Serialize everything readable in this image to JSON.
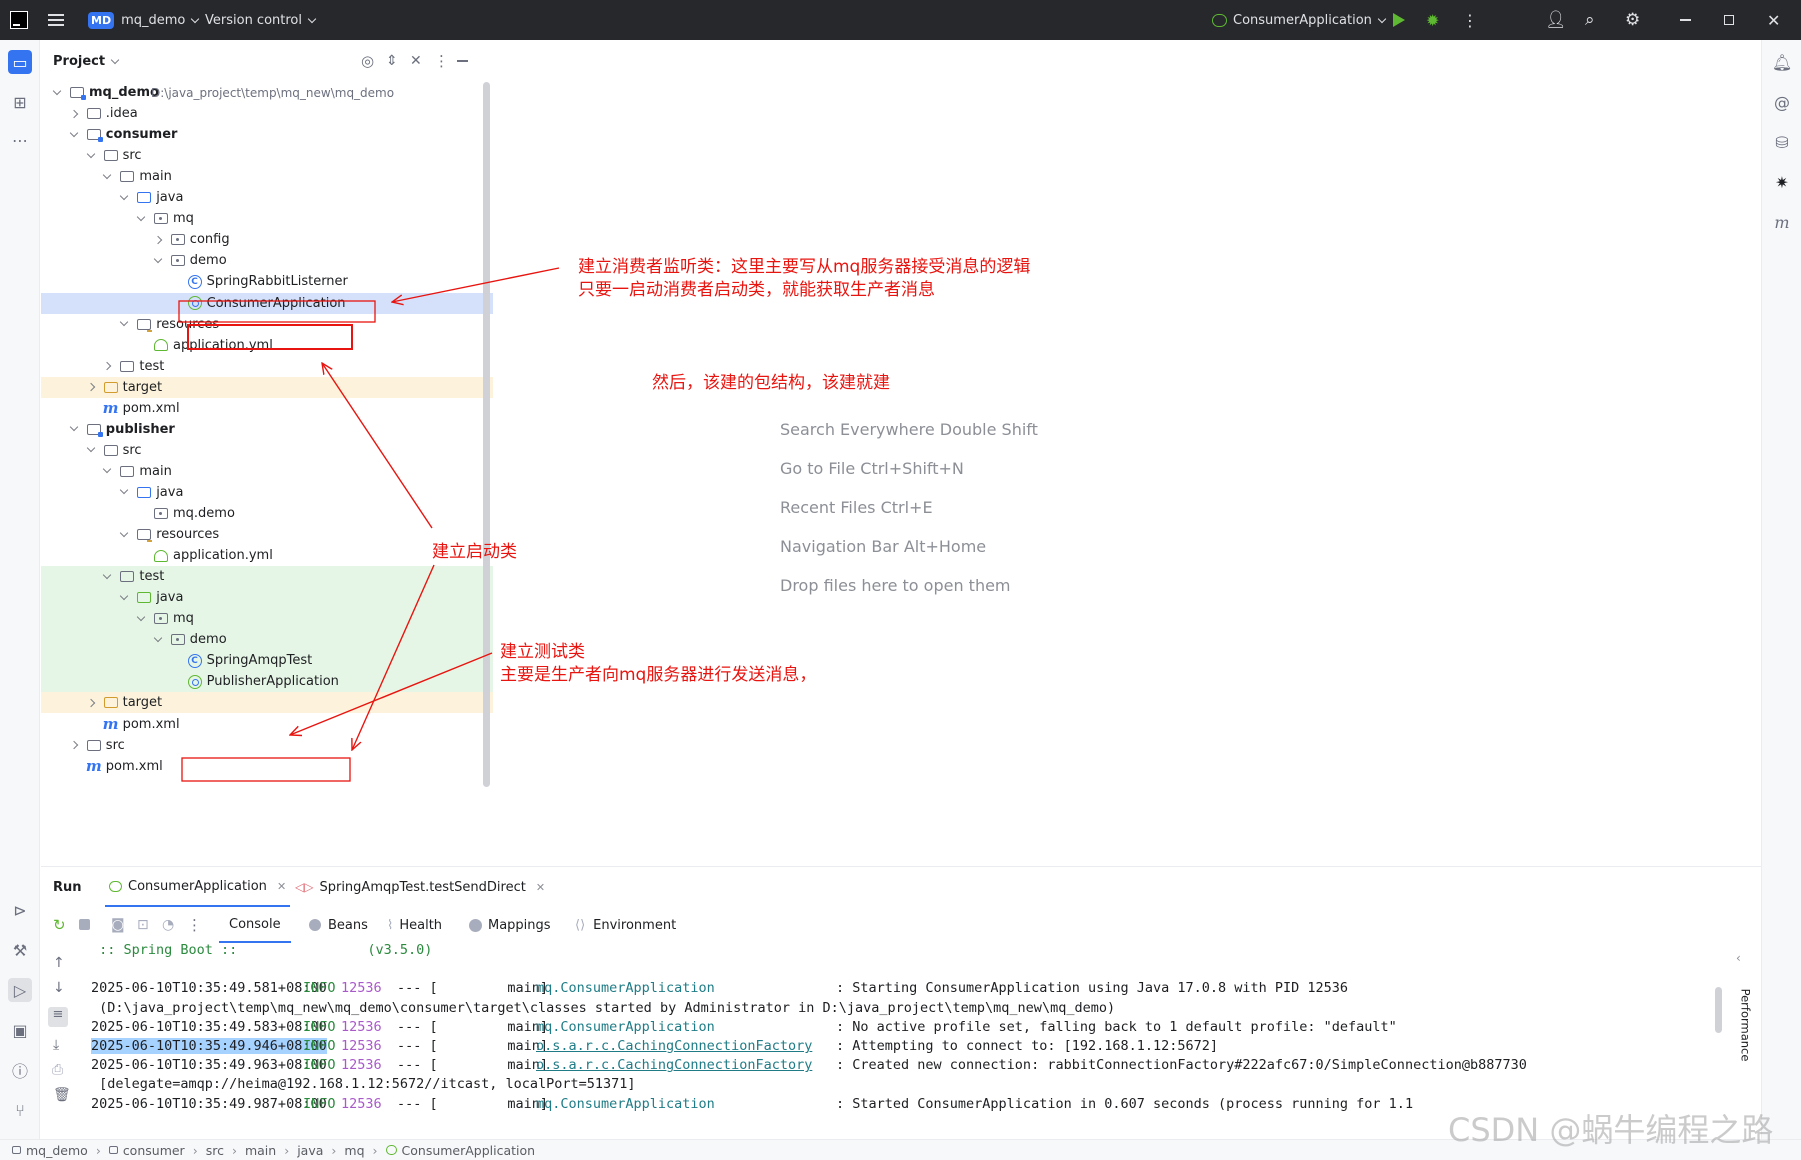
{
  "titlebar": {
    "app_icon": "intellij-icon",
    "project_badge": "MD",
    "project_name": "mq_demo",
    "vcs_label": "Version control",
    "run_config": "ConsumerApplication"
  },
  "project_panel": {
    "title": "Project",
    "tree": [
      {
        "label": "mq_demo",
        "path": "D:\\java_project\\temp\\mq_new\\mq_demo",
        "icon": "module-folder",
        "bold": true
      },
      {
        "label": ".idea",
        "icon": "folder"
      },
      {
        "label": "consumer",
        "icon": "module-folder",
        "bold": true
      },
      {
        "label": "src",
        "icon": "folder"
      },
      {
        "label": "main",
        "icon": "folder"
      },
      {
        "label": "java",
        "icon": "source-folder"
      },
      {
        "label": "mq",
        "icon": "package"
      },
      {
        "label": "config",
        "icon": "package"
      },
      {
        "label": "demo",
        "icon": "package"
      },
      {
        "label": "SpringRabbitListerner",
        "icon": "class"
      },
      {
        "label": "ConsumerApplication",
        "icon": "spring-boot"
      },
      {
        "label": "resources",
        "icon": "resources-folder"
      },
      {
        "label": "application.yml",
        "icon": "yaml"
      },
      {
        "label": "test",
        "icon": "folder"
      },
      {
        "label": "target",
        "icon": "excluded-folder"
      },
      {
        "label": "pom.xml",
        "icon": "maven"
      },
      {
        "label": "publisher",
        "icon": "module-folder",
        "bold": true
      },
      {
        "label": "src",
        "icon": "folder"
      },
      {
        "label": "main",
        "icon": "folder"
      },
      {
        "label": "java",
        "icon": "source-folder"
      },
      {
        "label": "mq.demo",
        "icon": "package"
      },
      {
        "label": "resources",
        "icon": "resources-folder"
      },
      {
        "label": "application.yml",
        "icon": "yaml"
      },
      {
        "label": "test",
        "icon": "folder"
      },
      {
        "label": "java",
        "icon": "test-folder"
      },
      {
        "label": "mq",
        "icon": "package"
      },
      {
        "label": "demo",
        "icon": "package"
      },
      {
        "label": "SpringAmqpTest",
        "icon": "test-class"
      },
      {
        "label": "PublisherApplication",
        "icon": "spring-boot"
      },
      {
        "label": "target",
        "icon": "excluded-folder"
      },
      {
        "label": "pom.xml",
        "icon": "maven"
      },
      {
        "label": "src",
        "icon": "folder"
      },
      {
        "label": "pom.xml",
        "icon": "maven"
      }
    ]
  },
  "editor_hints": [
    "Search Everywhere Double Shift",
    "Go to File Ctrl+Shift+N",
    "Recent Files Ctrl+E",
    "Navigation Bar Alt+Home",
    "Drop files here to open them"
  ],
  "annotations": {
    "listener_line1": "建立消费者监听类：这里主要写从mq服务器接受消息的逻辑",
    "listener_line2": "只要一启动消费者启动类，就能获取生产者消息",
    "package_note": "然后，该建的包结构，该建就建",
    "startup_class": "建立启动类",
    "test_line1": "建立测试类",
    "test_line2": "主要是生产者向mq服务器进行发送消息，",
    "color": "#e8140f"
  },
  "run_panel": {
    "title": "Run",
    "tabs": [
      "ConsumerApplication",
      "SpringAmqpTest.testSendDirect"
    ],
    "console_tabs": [
      "Console",
      "Beans",
      "Health",
      "Mappings",
      "Environment"
    ],
    "active_console_tab": "Console",
    "right_tool": "Performance",
    "lines": [
      {
        "text": " :: Spring Boot ::                (v3.5.0)"
      },
      {
        "text": ""
      },
      {
        "ts": "2025-06-10T10:35:49.581+08:00",
        "level": "INFO",
        "pid": "12536",
        "sep": "--- [",
        "thread": "           main]",
        "logger": "mq.ConsumerApplication",
        "msg": ": Starting ConsumerApplication using Java 17.0.8 with PID 12536"
      },
      {
        "text": " (D:\\java_project\\temp\\mq_new\\mq_demo\\consumer\\target\\classes started by Administrator in D:\\java_project\\temp\\mq_new\\mq_demo)"
      },
      {
        "ts": "2025-06-10T10:35:49.583+08:00",
        "level": "INFO",
        "pid": "12536",
        "sep": "--- [",
        "thread": "           main]",
        "logger": "mq.ConsumerApplication",
        "msg": ": No active profile set, falling back to 1 default profile: \"default\""
      },
      {
        "ts": "2025-06-10T10:35:49.946+08:00",
        "level": "INFO",
        "pid": "12536",
        "sep": "--- [",
        "thread": "           main]",
        "logger": "o.s.a.r.c.CachingConnectionFactory",
        "msg": ": Attempting to connect to: [192.168.1.12:5672]",
        "selected": true
      },
      {
        "ts": "2025-06-10T10:35:49.963+08:00",
        "level": "INFO",
        "pid": "12536",
        "sep": "--- [",
        "thread": "           main]",
        "logger": "o.s.a.r.c.CachingConnectionFactory",
        "msg": ": Created new connection: rabbitConnectionFactory#222afc67:0/SimpleConnection@b887730"
      },
      {
        "text": " [delegate=amqp://heima@192.168.1.12:5672//itcast, localPort=51371]"
      },
      {
        "ts": "2025-06-10T10:35:49.987+08:00",
        "level": "INFO",
        "pid": "12536",
        "sep": "--- [",
        "thread": "           main]",
        "logger": "mq.ConsumerApplication",
        "msg": ": Started ConsumerApplication in 0.607 seconds (process running for 1.1"
      }
    ]
  },
  "statusbar": {
    "crumbs": [
      "mq_demo",
      "consumer",
      "src",
      "main",
      "java",
      "mq",
      "ConsumerApplication"
    ]
  },
  "watermark": "CSDN @蜗牛编程之路"
}
